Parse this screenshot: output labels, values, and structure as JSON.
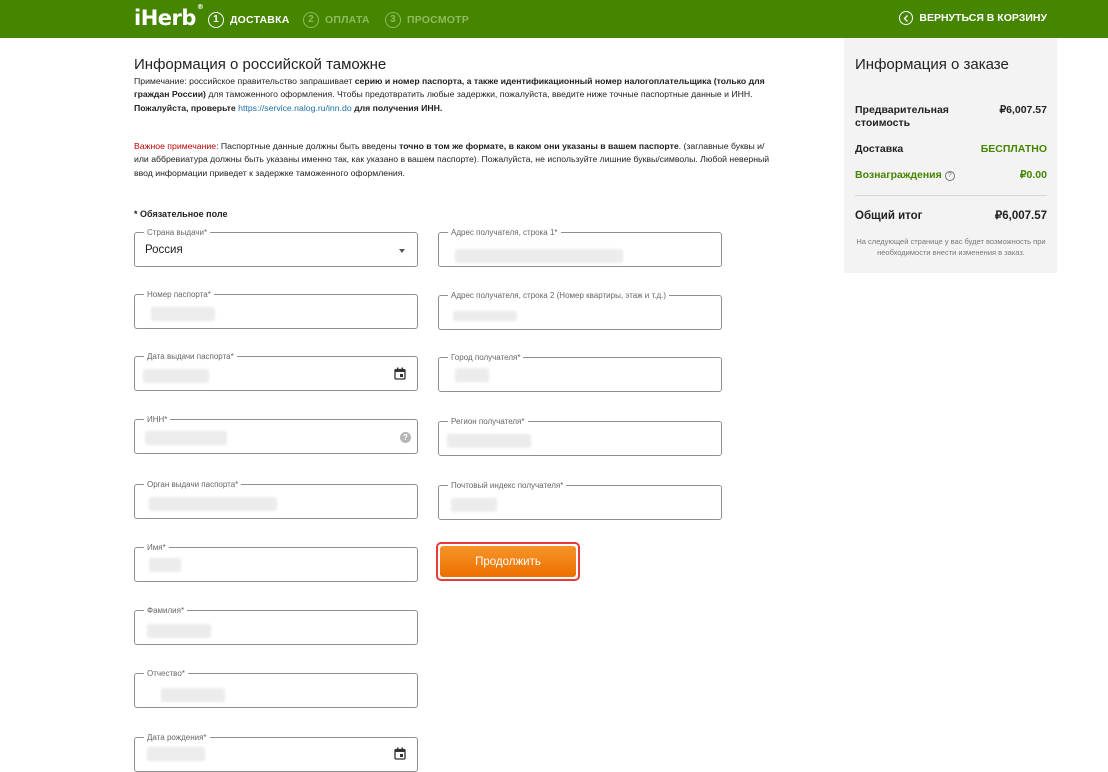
{
  "header": {
    "logo": "iHerb",
    "logo_mark": "®",
    "steps": [
      {
        "num": "1",
        "label": "ДОСТАВКА"
      },
      {
        "num": "2",
        "label": "ОПЛАТА"
      },
      {
        "num": "3",
        "label": "ПРОСМОТР"
      }
    ],
    "back_label": "ВЕРНУТЬСЯ В КОРЗИНУ",
    "colors": {
      "bar": "#458500",
      "inactive_step": "#8fbc5e"
    }
  },
  "customs": {
    "title": "Информация о российской таможне",
    "note": {
      "prefix": "Примечание: российское правительство запрашивает ",
      "bold1": "серию и номер паспорта, а также идентификационный номер налогоплательщика (только для граждан России)",
      "mid": " для таможенного оформления. Чтобы предотвратить любые задержки, пожалуйста, введите ниже точные паспортные данные и ИНН. ",
      "bold2": "Пожалуйста, проверьте",
      "link": "https://service.nalog.ru/inn.do",
      "bold3": " для получения ИНН."
    },
    "important": {
      "red": "Важное примечание",
      "colon": ": Паспортные данные должны быть введены ",
      "bold": "точно в том же формате, в каком они указаны в вашем паспорте",
      "rest": ". (заглавные буквы и/или аббревиатура должны быть указаны именно так, как указано в вашем паспорте). Пожалуйста, не используйте лишние буквы/символы. Любой неверный ввод информации приведет к задержке таможенного оформления."
    },
    "required_note": "* Обязательное поле"
  },
  "form": {
    "left": [
      {
        "label": "Страна выдачи*",
        "value": "Россия"
      },
      {
        "label": "Номер паспорта*"
      },
      {
        "label": "Дата выдачи паспорта*"
      },
      {
        "label": "ИНН*",
        "help": "?"
      },
      {
        "label": "Орган выдачи паспорта*"
      },
      {
        "label": "Имя*"
      },
      {
        "label": "Фамилия*"
      },
      {
        "label": "Отчество*"
      },
      {
        "label": "Дата рождения*"
      }
    ],
    "right": [
      {
        "label": "Адрес получателя, строка 1*"
      },
      {
        "label": "Адрес получателя, строка 2 (Номер квартиры, этаж и т.д.)"
      },
      {
        "label": "Город получателя*"
      },
      {
        "label": "Регион получателя*"
      },
      {
        "label": "Почтовый индекс получателя*"
      }
    ],
    "continue_label": "Продолжить",
    "continue_color": "#ee6f00"
  },
  "summary": {
    "title": "Информация о заказе",
    "subtotal_label": "Предварительная стоимость",
    "subtotal_value": "₽6,007.57",
    "shipping_label": "Доставка",
    "shipping_value": "БЕСПЛАТНО",
    "rewards_label": "Вознаграждения",
    "rewards_info": "?",
    "rewards_value": "₽0.00",
    "total_label": "Общий итог",
    "total_value": "₽6,007.57",
    "footnote": "На следующей странице у вас будет возможность при необходимости внести изменения в заказ."
  }
}
